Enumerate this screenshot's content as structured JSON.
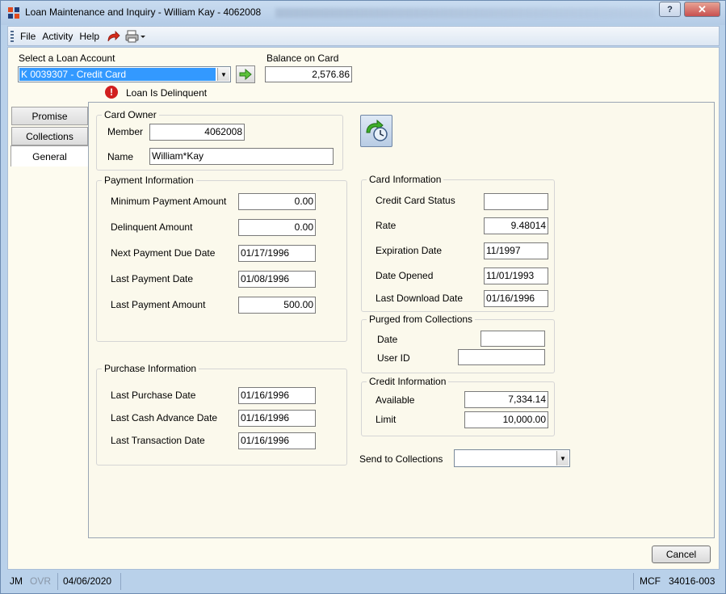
{
  "window": {
    "title": "Loan Maintenance and Inquiry - William Kay - 4062008",
    "help_label": "?",
    "close_label": "✕"
  },
  "menu": {
    "items": [
      "File",
      "Activity",
      "Help"
    ],
    "icons": [
      "redo-arrow-icon",
      "print-icon"
    ]
  },
  "loan_select": {
    "label": "Select a Loan Account",
    "value": "K  0039307 - Credit Card"
  },
  "balance": {
    "label": "Balance on Card",
    "value": "2,576.86"
  },
  "delinquent_message": "Loan Is Delinquent",
  "tabs": [
    {
      "label": "Promise"
    },
    {
      "label": "Collections"
    },
    {
      "label": "General"
    }
  ],
  "card_owner": {
    "title": "Card Owner",
    "member_label": "Member",
    "member_value": "4062008",
    "name_label": "Name",
    "name_value": "William*Kay"
  },
  "payment_info": {
    "title": "Payment Information",
    "rows": [
      {
        "label": "Minimum Payment Amount",
        "value": "0.00"
      },
      {
        "label": "Delinquent Amount",
        "value": "0.00"
      },
      {
        "label": "Next Payment Due Date",
        "value": "01/17/1996"
      },
      {
        "label": "Last Payment Date",
        "value": "01/08/1996"
      },
      {
        "label": "Last Payment Amount",
        "value": "500.00"
      }
    ]
  },
  "purchase_info": {
    "title": "Purchase Information",
    "rows": [
      {
        "label": "Last Purchase Date",
        "value": "01/16/1996"
      },
      {
        "label": "Last Cash Advance Date",
        "value": "01/16/1996"
      },
      {
        "label": "Last Transaction Date",
        "value": "01/16/1996"
      }
    ]
  },
  "card_info": {
    "title": "Card Information",
    "rows": [
      {
        "label": "Credit Card Status",
        "value": ""
      },
      {
        "label": "Rate",
        "value": "9.48014"
      },
      {
        "label": "Expiration Date",
        "value": "11/1997"
      },
      {
        "label": "Date Opened",
        "value": "11/01/1993"
      },
      {
        "label": "Last Download Date",
        "value": "01/16/1996"
      }
    ]
  },
  "purged": {
    "title": "Purged from Collections",
    "date_label": "Date",
    "date_value": "",
    "user_label": "User ID",
    "user_value": ""
  },
  "credit_info": {
    "title": "Credit Information",
    "available_label": "Available",
    "available_value": "7,334.14",
    "limit_label": "Limit",
    "limit_value": "10,000.00"
  },
  "send_to_collections": {
    "label": "Send to Collections",
    "value": ""
  },
  "cancel_label": "Cancel",
  "status": {
    "user": "JM",
    "mode": "OVR",
    "date": "04/06/2020",
    "code": "MCF",
    "screen_id": "34016-003"
  },
  "colors": {
    "selection": "#3399ff",
    "window_frame": "#b9d1ea",
    "form_bg": "#fdfbef",
    "error": "#d11f1f"
  }
}
